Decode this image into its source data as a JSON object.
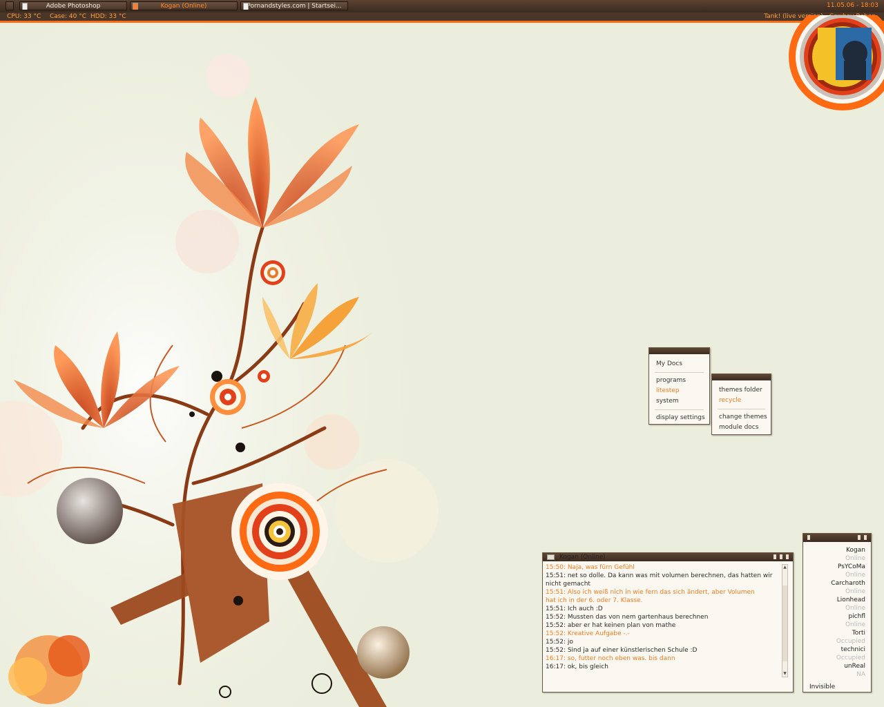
{
  "taskbar": {
    "tasks": [
      {
        "label": "Adobe Photoshop",
        "active": false
      },
      {
        "label": "Kogan (Online)",
        "active": true
      },
      {
        "label": "Pornandstyles.com | Startsei...",
        "active": false
      }
    ],
    "clock": "11.05.06 - 18:03"
  },
  "stats": {
    "cpu": "CPU:  33 °C",
    "case": "Case: 40 °C",
    "hdd": "HDD:  33 °C",
    "now_playing": "Tank! (live version) - Cowboy Bebop"
  },
  "menu1": {
    "items": [
      {
        "label": "My Docs",
        "highlight": false
      },
      {
        "label": "programs",
        "highlight": false
      },
      {
        "label": "litestep",
        "highlight": true
      },
      {
        "label": "system",
        "highlight": false
      },
      {
        "label": "display settings",
        "highlight": false
      }
    ]
  },
  "menu2": {
    "items": [
      {
        "label": "themes folder",
        "highlight": false
      },
      {
        "label": "recycle",
        "highlight": true
      },
      {
        "label": "change themes",
        "highlight": false
      },
      {
        "label": "module docs",
        "highlight": false
      }
    ]
  },
  "chat": {
    "title": "Kogan (Online)",
    "lines": [
      {
        "text": "15:50: Naja, was fürn Gefühl",
        "self": true
      },
      {
        "text": "15:51: net so dolle. Da kann was mit volumen berechnen, das hatten wir",
        "self": false
      },
      {
        "text": "nicht gemacht",
        "self": false
      },
      {
        "text": "15:51: Also ich weiß nich in wie fern das sich ändert, aber Volumen",
        "self": true
      },
      {
        "text": "hat ich in der 6. oder 7. Klasse.",
        "self": true
      },
      {
        "text": "15:51: Ich auch :D",
        "self": false
      },
      {
        "text": "15:52: Mussten das von nem gartenhaus berechnen",
        "self": false
      },
      {
        "text": "15:52: aber er hat keinen plan von mathe",
        "self": false
      },
      {
        "text": "15:52: Kreative Aufgabe -.-",
        "self": true
      },
      {
        "text": "15:52: jo",
        "self": false
      },
      {
        "text": "15:52: Sind ja auf einer künstlerischen Schule :D",
        "self": false
      },
      {
        "text": "16:17: so, futter noch eben was. bis dann",
        "self": true
      },
      {
        "text": "16:17: ok, bis gleich",
        "self": false
      }
    ]
  },
  "contacts": {
    "list": [
      {
        "name": "Kogan",
        "status": "Online"
      },
      {
        "name": "PsYCoMa",
        "status": "Online"
      },
      {
        "name": "Carcharoth",
        "status": "Online"
      },
      {
        "name": "Lionhead",
        "status": "Online"
      },
      {
        "name": "pichfl",
        "status": "Online"
      },
      {
        "name": "Torti",
        "status": "Occupied"
      },
      {
        "name": "technici",
        "status": "Occupied"
      },
      {
        "name": "unReal",
        "status": "NA"
      }
    ],
    "my_status": "Invisible"
  },
  "colors": {
    "accent": "#ff7a1f",
    "bar": "#3f2d21",
    "wallpaper": "#eceedd"
  }
}
